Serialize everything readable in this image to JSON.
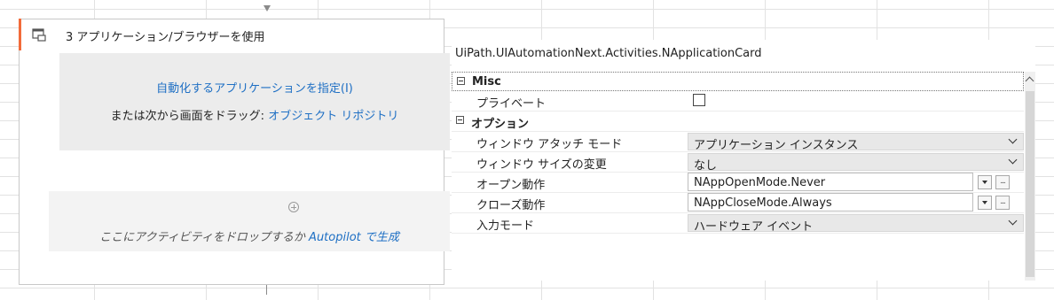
{
  "activity": {
    "title": "3 アプリケーション/ブラウザーを使用",
    "indicate_link": "自動化するアプリケーションを指定(I)",
    "drag_prefix": "または次から画面をドラッグ: ",
    "repository_link": "オブジェクト リポジトリ",
    "drop_prefix": "ここにアクティビティをドロップするか ",
    "autopilot_link": "Autopilot で生成"
  },
  "properties": {
    "class_name": "UiPath.UIAutomationNext.Activities.NApplicationCard",
    "categories": [
      {
        "name": "Misc",
        "rows": [
          {
            "label": "プライベート",
            "type": "checkbox",
            "checked": false
          }
        ]
      },
      {
        "name": "オプション",
        "rows": [
          {
            "label": "ウィンドウ アタッチ モード",
            "type": "combo",
            "value": "アプリケーション インスタンス"
          },
          {
            "label": "ウィンドウ サイズの変更",
            "type": "combo",
            "value": "なし"
          },
          {
            "label": "オープン動作",
            "type": "textbox",
            "value": "NAppOpenMode.Never"
          },
          {
            "label": "クローズ動作",
            "type": "textbox",
            "value": "NAppCloseMode.Always"
          },
          {
            "label": "入力モード",
            "type": "combo",
            "value": "ハードウェア イベント"
          }
        ]
      }
    ]
  },
  "colors": {
    "accent": "#f26b3a",
    "link": "#1e6fc4"
  },
  "icons": [
    "use-application-icon",
    "add-activity-plus-icon",
    "chevron-down-icon",
    "ellipsis-icon",
    "scroll-up-icon"
  ]
}
